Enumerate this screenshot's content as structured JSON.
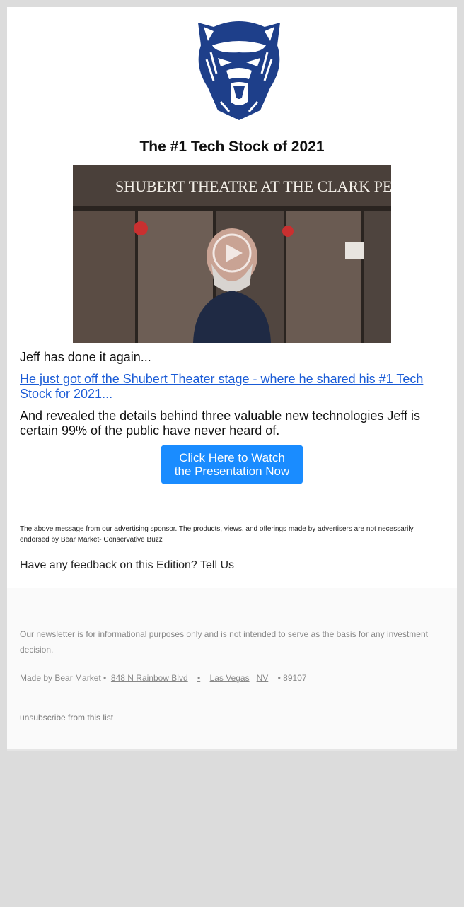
{
  "headline": "The #1 Tech Stock of 2021",
  "video": {
    "sign_text": "SHUBERT THEATRE AT THE CLARK PERFORM",
    "play_icon": "play-icon"
  },
  "body": {
    "intro": "Jeff has done it again...",
    "link_text": "He just got off the Shubert Theater stage - where he shared his #1 Tech Stock for 2021...",
    "detail": "And revealed the details behind three valuable new technologies Jeff is certain 99% of the public have never heard of."
  },
  "cta": {
    "line1": "Click Here to Watch",
    "line2": "the Presentation Now"
  },
  "disclaimer": "The above message from our advertising sponsor. The products, views, and offerings made by advertisers are not necessarily endorsed by Bear Market- Conservative Buzz",
  "feedback": {
    "glyph": "",
    "text": "Have any feedback on this Edition?",
    "link": "Tell Us"
  },
  "footer": {
    "note": "Our newsletter is for informational purposes only and is not intended to serve as the basis for any investment decision.",
    "made_by": "Made by Bear Market •",
    "street": "848 N Rainbow Blvd",
    "sep1": "•",
    "city": "Las Vegas",
    "state": "NV",
    "sep2": "•",
    "zip": "89107",
    "unsubscribe": "unsubscribe from this list"
  },
  "colors": {
    "link": "#1a5bd6",
    "button": "#1a8cff",
    "logo": "#1e3f8a",
    "page_bg": "#dcdcdc"
  }
}
